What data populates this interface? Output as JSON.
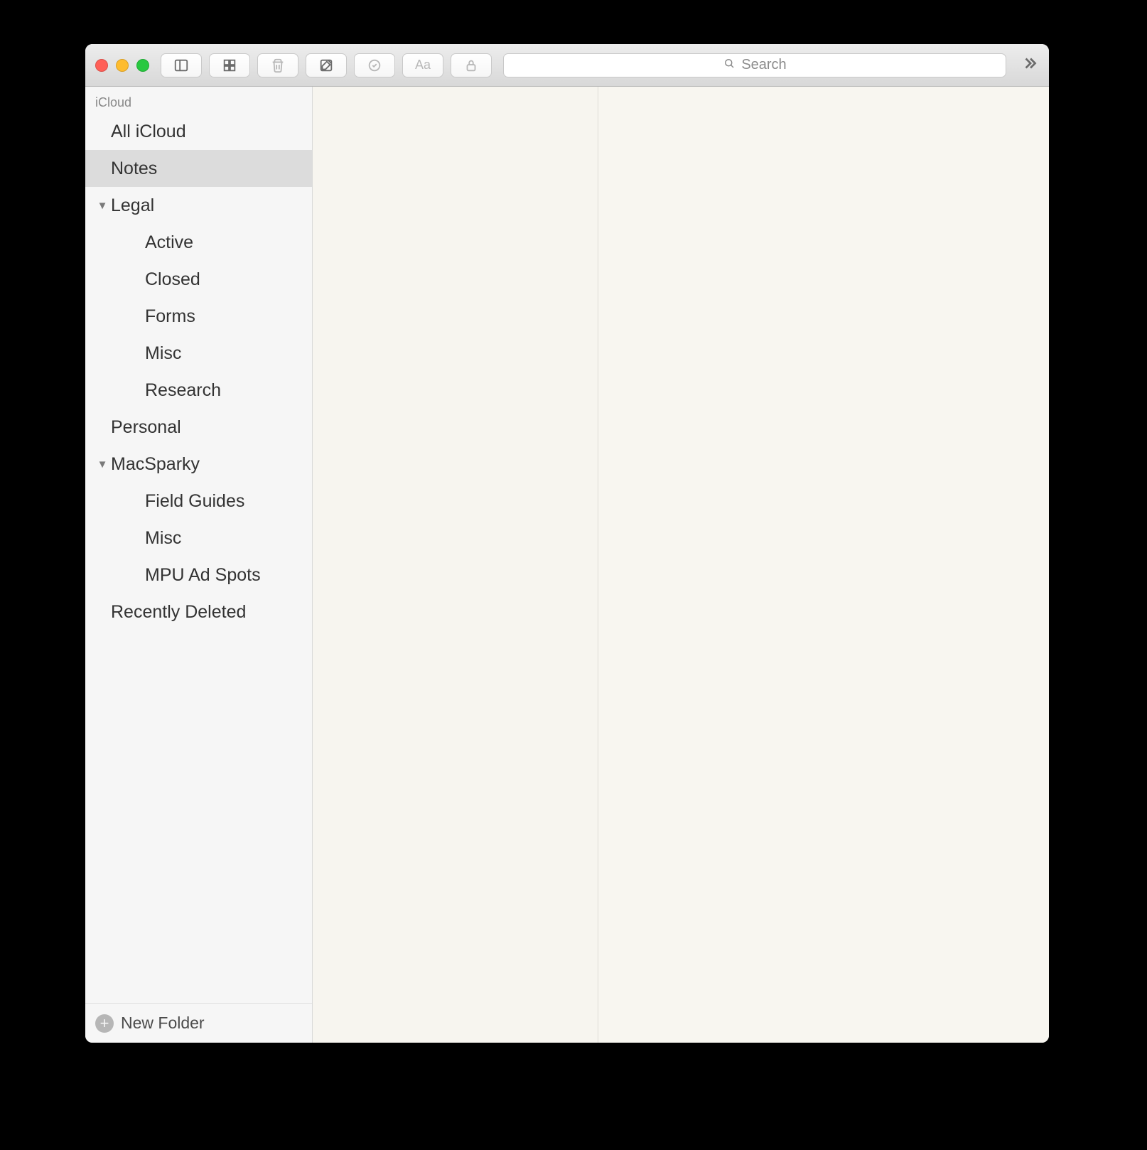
{
  "toolbar": {
    "search_placeholder": "Search"
  },
  "sidebar": {
    "section_label": "iCloud",
    "rows": [
      {
        "label": "All iCloud",
        "depth": 1,
        "expandable": false,
        "selected": false
      },
      {
        "label": "Notes",
        "depth": 1,
        "expandable": false,
        "selected": true
      },
      {
        "label": "Legal",
        "depth": 1,
        "expandable": true,
        "selected": false
      },
      {
        "label": "Active",
        "depth": 2,
        "expandable": false,
        "selected": false
      },
      {
        "label": "Closed",
        "depth": 2,
        "expandable": false,
        "selected": false
      },
      {
        "label": "Forms",
        "depth": 2,
        "expandable": false,
        "selected": false
      },
      {
        "label": "Misc",
        "depth": 2,
        "expandable": false,
        "selected": false
      },
      {
        "label": "Research",
        "depth": 2,
        "expandable": false,
        "selected": false
      },
      {
        "label": "Personal",
        "depth": 1,
        "expandable": false,
        "selected": false
      },
      {
        "label": "MacSparky",
        "depth": 1,
        "expandable": true,
        "selected": false
      },
      {
        "label": "Field Guides",
        "depth": 2,
        "expandable": false,
        "selected": false
      },
      {
        "label": "Misc",
        "depth": 2,
        "expandable": false,
        "selected": false
      },
      {
        "label": "MPU Ad Spots",
        "depth": 2,
        "expandable": false,
        "selected": false
      },
      {
        "label": "Recently Deleted",
        "depth": 1,
        "expandable": false,
        "selected": false
      }
    ],
    "footer_label": "New Folder"
  }
}
